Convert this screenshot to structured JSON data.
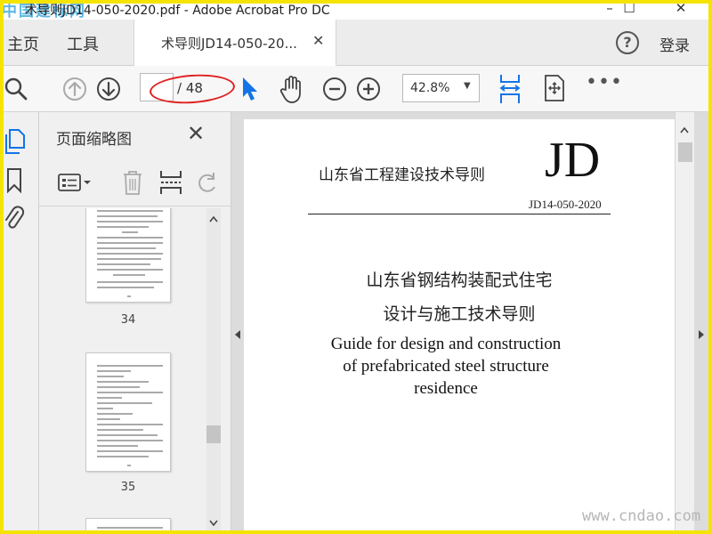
{
  "window": {
    "title": "术导则JD14-050-2020.pdf - Adobe Acrobat Pro DC",
    "watermark": "中国建标网",
    "min_label": "–",
    "max_label": "☐",
    "close_label": "✕"
  },
  "menu": {
    "home": "主页",
    "tools": "工具"
  },
  "tab": {
    "label": "术导则JD14-050-20...",
    "close": "✕"
  },
  "header_right": {
    "help": "?",
    "login": "登录"
  },
  "toolbar": {
    "current_page": "",
    "page_total": "/ 48",
    "zoom": "42.8%",
    "zoom_caret": "▼",
    "more": "•••",
    "accent": "#1473e6",
    "annotation_color": "#e02020"
  },
  "thumbnails": {
    "title": "页面缩略图",
    "close": "✕",
    "pages": [
      {
        "number": "34"
      },
      {
        "number": "35"
      }
    ]
  },
  "document": {
    "header_cn": "山东省工程建设技术导则",
    "logo": "JD",
    "code": "JD14-050-2020",
    "title_cn_1": "山东省钢结构装配式住宅",
    "title_cn_2": "设计与施工技术导则",
    "title_en_1": "Guide for design and construction",
    "title_en_2": "of prefabricated steel structure",
    "title_en_3": "residence"
  },
  "watermark_bottom": "www.cndao.com"
}
